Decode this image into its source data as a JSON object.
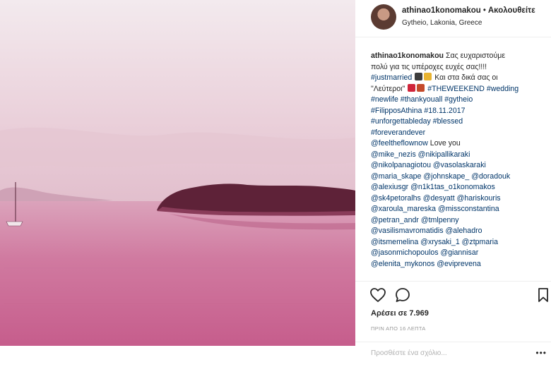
{
  "post": {
    "username": "athinao1konomakou",
    "follow_label": "Ακολουθείτε",
    "separator": "•",
    "location": "Gytheio, Lakonia, Greece",
    "caption": {
      "author": "athinao1konomakou",
      "l1_text": "Σας ευχαριστούμε",
      "l2": "πολύ για τις υπέροχες ευχές σας!!!!",
      "l3_tag": "#justmarried",
      "l3_text": "Και στα δικά σας οι",
      "l4_text": "\"Λεύτεροι\"",
      "l4_tag1": "#THEWEEKEND",
      "l4_tag2": "#wedding",
      "l5": "#newlife #thankyouall #gytheio",
      "l6": "#FilipposAthina #18.11.2017",
      "l7": "#unforgettableday #blessed",
      "l8": "#foreverandever",
      "l9_tag": "@feeltheflownow",
      "l9_text": "Love you",
      "l10": "@mike_nezis @nikipallikaraki",
      "l11": "@nikolpanagiotou @vasolaskaraki",
      "l12": "@maria_skape @johnskape_ @doradouk",
      "l13": "@alexiusgr @n1k1tas_o1konomakos",
      "l14": "@sk4petoralhs @desyatt @hariskouris",
      "l15": "@xaroula_mareska @missconstantina",
      "l16": "@petran_andr @tmlpenny",
      "l17": "@vasilismavromatidis @alehadro",
      "l18": "@itsmemelina @xrysaki_1 @ztpmaria",
      "l19": "@jasonmichopoulos @giannisar",
      "l20": "@elenita_mykonos @eviprevena"
    },
    "likes": "Αρέσει σε 7.969",
    "time_ago": "ΠΡΙΝ ΑΠΟ 16 ΛΕΠΤΑ",
    "comment_placeholder": "Προσθέστε ένα σχόλιο...",
    "more_label": "•••"
  },
  "icons": {
    "like": "heart-icon",
    "comment": "comment-bubble-icon",
    "save": "bookmark-icon"
  },
  "colors": {
    "hashtag": "#003569",
    "photo_tint": "#c9628f"
  }
}
